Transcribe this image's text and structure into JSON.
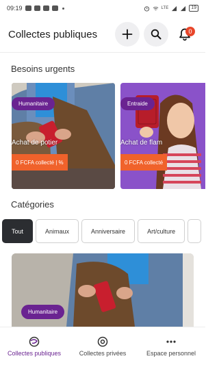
{
  "status_bar": {
    "time": "09:19",
    "right_text": "LTE",
    "battery": "19"
  },
  "header": {
    "title": "Collectes publiques",
    "add_icon": "plus-icon",
    "search_icon": "search-icon",
    "notification_icon": "bell-icon",
    "notification_count": "0"
  },
  "urgent": {
    "title": "Besoins urgents",
    "cards": [
      {
        "tag": "Humanitaire",
        "name": "Achat de potier",
        "amount": "0 FCFA collecté | %"
      },
      {
        "tag": "Entraide",
        "name": "Achat de flam",
        "amount": "0 FCFA collecté"
      }
    ]
  },
  "categories": {
    "title": "Catégories",
    "items": [
      "Tout",
      "Animaux",
      "Anniversaire",
      "Art/culture"
    ]
  },
  "featured": {
    "tag": "Humanitaire"
  },
  "bottom_nav": [
    {
      "label": "Collectes publiques",
      "icon": "globe-icon"
    },
    {
      "label": "Collectes privées",
      "icon": "at-icon"
    },
    {
      "label": "Espace personnel",
      "icon": "more-icon"
    }
  ],
  "colors": {
    "accent": "#6a2391",
    "amount_bar": "#f0622b",
    "badge": "#e8462a",
    "active_chip": "#2b2d31"
  }
}
